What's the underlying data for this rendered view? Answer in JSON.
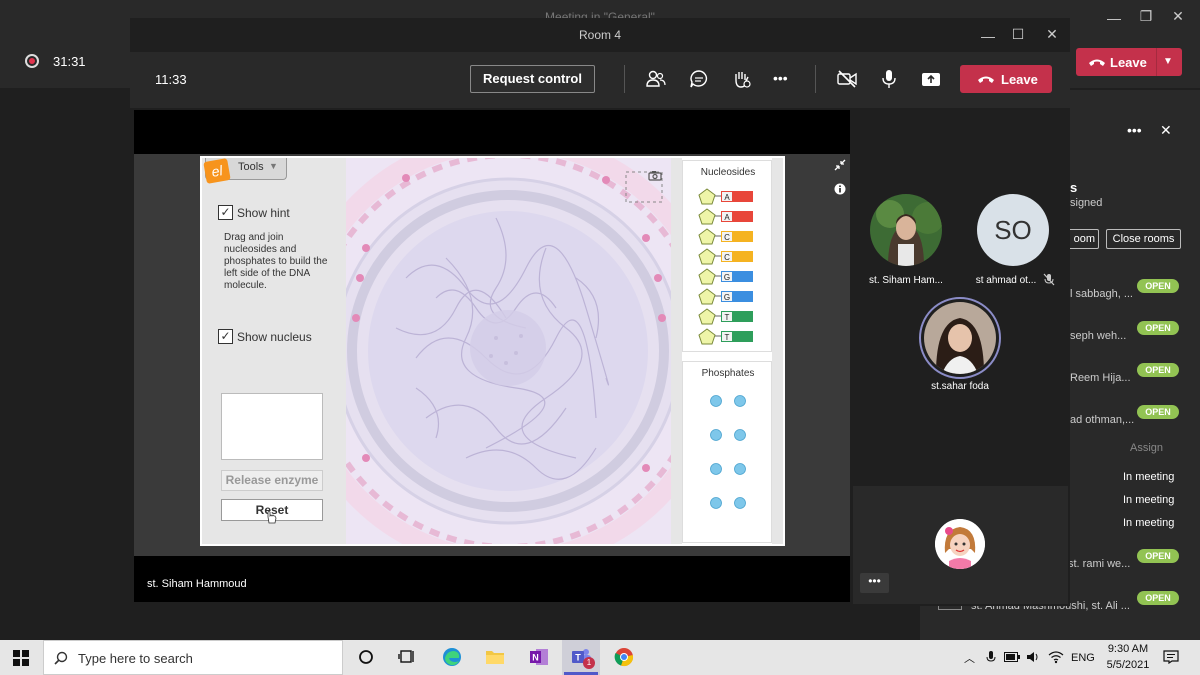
{
  "background_window": {
    "title": "Meeting in \"General\"",
    "recording_time": "31:31",
    "leave_label": "Leave",
    "panel": {
      "heading_partial": "s",
      "subheading_partial": "signed",
      "room_button_partial": "oom",
      "close_rooms_label": "Close rooms",
      "rooms": [
        {
          "name": "l sabbagh, ...",
          "status": "OPEN"
        },
        {
          "name": "seph weh...",
          "status": "OPEN"
        },
        {
          "name": "Reem Hija...",
          "status": "OPEN"
        },
        {
          "name": "ad othman,...",
          "status": "OPEN"
        }
      ],
      "assign_label": "Assign",
      "in_meeting": [
        "In meeting",
        "In meeting",
        "In meeting"
      ],
      "rooms_bottom": [
        {
          "name": "st. rami we...",
          "status": "OPEN"
        },
        {
          "name": "st. Ahmad Mashmoushi, st. Ali ...",
          "status": "OPEN"
        }
      ]
    }
  },
  "room_window": {
    "title": "Room 4",
    "call_time": "11:33",
    "request_control_label": "Request control",
    "leave_label": "Leave",
    "presenter_name": "st. Siham Hammoud"
  },
  "simulation": {
    "tools_label": "Tools",
    "logo_letter": "el",
    "show_hint_label": "Show hint",
    "hint_text": "Drag and join nucleosides and phosphates to build the left side of the DNA molecule.",
    "show_nucleus_label": "Show nucleus",
    "release_enzyme_label": "Release enzyme",
    "reset_label": "Reset",
    "nucleosides_title": "Nucleosides",
    "nucleosides": [
      {
        "base": "A",
        "color": "#e8463a"
      },
      {
        "base": "A",
        "color": "#e8463a"
      },
      {
        "base": "C",
        "color": "#f5b321"
      },
      {
        "base": "C",
        "color": "#f5b321"
      },
      {
        "base": "G",
        "color": "#3b8ee0"
      },
      {
        "base": "G",
        "color": "#3b8ee0"
      },
      {
        "base": "T",
        "color": "#2e9e5b"
      },
      {
        "base": "T",
        "color": "#2e9e5b"
      }
    ],
    "phosphates_title": "Phosphates",
    "phosphate_color": "#7ec7ea"
  },
  "participants": {
    "p1_name": "st. Siham Ham...",
    "p2_initials": "SO",
    "p2_name": "st ahmad ot...",
    "p3_name": "st.sahar foda"
  },
  "taskbar": {
    "search_placeholder": "Type here to search",
    "language": "ENG",
    "time": "9:30 AM",
    "date": "5/5/2021",
    "teams_badge": "1"
  }
}
